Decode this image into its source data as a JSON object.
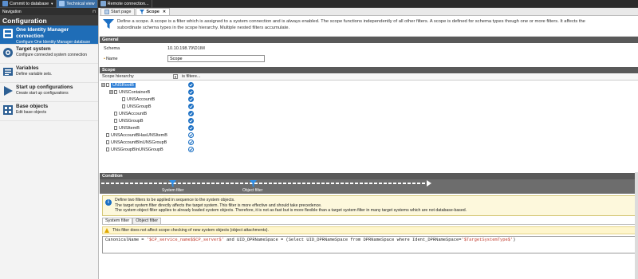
{
  "toolbar": {
    "commit": "Commit to database",
    "technical": "Technical view",
    "remote": "Remote connection..."
  },
  "sidebar": {
    "header": "Navigation",
    "pin": "⊓",
    "title": "Configuration",
    "items": [
      {
        "name": "One Identity Manager connection",
        "desc": "Configure One Identity Manager database connection",
        "icon": "database-icon"
      },
      {
        "name": "Target system",
        "desc": "Configure connected system connection",
        "icon": "target-system-icon"
      },
      {
        "name": "Variables",
        "desc": "Define variable sets.",
        "icon": "variables-icon"
      },
      {
        "name": "Start up configurations",
        "desc": "Create start up configurations",
        "icon": "startup-icon"
      },
      {
        "name": "Base objects",
        "desc": "Edit base objects",
        "icon": "base-objects-icon"
      }
    ]
  },
  "tabs": [
    {
      "label": "Start page"
    },
    {
      "label": "Scope"
    }
  ],
  "info": {
    "line1": "Define a scope. A scope is a filter which is assigned to a system connection and is always enabled. The scope functions independently of all other filters. A scope is defined for schema types though one or more filters. It affects the",
    "line2": "subordinate schema types in the scope hierarchy. Multiple nested filters accumulate."
  },
  "general": {
    "header": "General",
    "schema_label": "Schema",
    "schema_value": "10.10.198.79\\D1IM",
    "name_label": "Name",
    "name_value": "Scope"
  },
  "scope": {
    "header": "Scope",
    "col_hierarchy": "Scope hierarchy",
    "col_filter": "is filtere...",
    "nodes": [
      {
        "label": "UNSRootB",
        "expander": "⊟",
        "filtered": "solid"
      },
      {
        "label": "UNSContainerB",
        "expander": "⊟",
        "filtered": "solid"
      },
      {
        "label": "UNSAccountB",
        "expander": "",
        "filtered": "solid"
      },
      {
        "label": "UNSGroupB",
        "expander": "",
        "filtered": "solid"
      },
      {
        "label": "UNSAccountB",
        "expander": "",
        "filtered": "solid"
      },
      {
        "label": "UNSGroupB",
        "expander": "",
        "filtered": "solid"
      },
      {
        "label": "UNSItemB",
        "expander": "",
        "filtered": "solid"
      },
      {
        "label": "UNSAccountBHasUNSItemB",
        "expander": "",
        "filtered": "outline"
      },
      {
        "label": "UNSAccountBInUNSGroupB",
        "expander": "",
        "filtered": "outline"
      },
      {
        "label": "UNSGroupBInUNSGroupB",
        "expander": "",
        "filtered": "outline"
      }
    ]
  },
  "condition": {
    "header": "Condition",
    "system_filter": "System filter",
    "object_filter": "Object filter",
    "note1": "Define two filters to be applied in sequence to the system objects.",
    "note2": "The target system filter directly affects the target system. This filter is more effective and should take precedence.",
    "note3": "The system object filter applies to already loaded system objects. Therefore, it is not as fast but is more flexible than a target system filter in many target systems which are not database-based.",
    "subtab1": "System filter",
    "subtab2": "Object filter",
    "warning": "This filter does not affect scope checking of new system objects (object attachments).",
    "code_a": "CanonicalName = ",
    "code_b": "'$CP_service_name$$CP_server$'",
    "code_c": " and UID_DPRNameSpace = (Select UID_DPRNameSpace from DPRNameSpace where Ident_DPRNameSpace=",
    "code_d": "'$TargetSystemType$'",
    "code_e": ")"
  }
}
